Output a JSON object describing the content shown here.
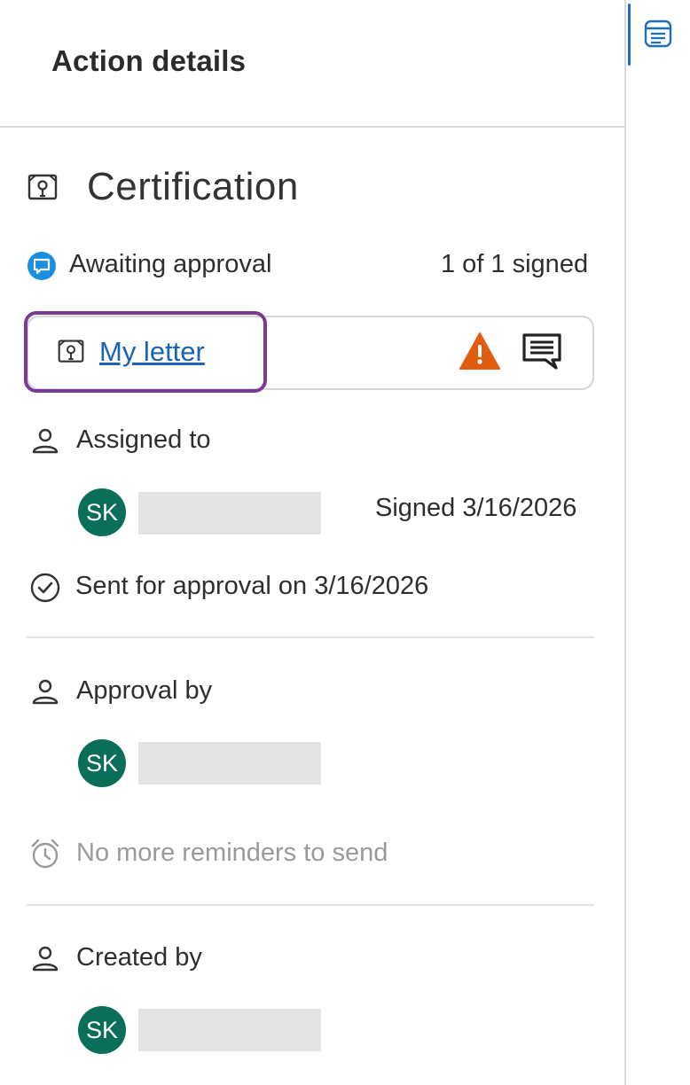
{
  "header": {
    "title": "Action details"
  },
  "section": {
    "title": "Certification",
    "icon": "certificate-icon"
  },
  "status": {
    "label": "Awaiting approval",
    "count": "1 of 1 signed",
    "icon": "chat-bubble-icon",
    "color": "#1a8fe0"
  },
  "document": {
    "name": "My letter",
    "icon": "certificate-icon",
    "warning_icon": "warning-icon",
    "comment_icon": "comment-icon",
    "warning_color": "#e05d10",
    "highlight_color": "#7b3a96"
  },
  "assigned": {
    "label": "Assigned to",
    "initials": "SK",
    "signed": "Signed 3/16/2026"
  },
  "sent": {
    "label": "Sent for approval on 3/16/2026"
  },
  "approval": {
    "label": "Approval by",
    "initials": "SK"
  },
  "reminders": {
    "label": "No more reminders to send"
  },
  "created": {
    "label": "Created by",
    "initials": "SK"
  },
  "rail": {
    "icon": "details-panel-icon",
    "accent": "#1c6fc0"
  },
  "colors": {
    "avatar": "#0b6e5a"
  }
}
